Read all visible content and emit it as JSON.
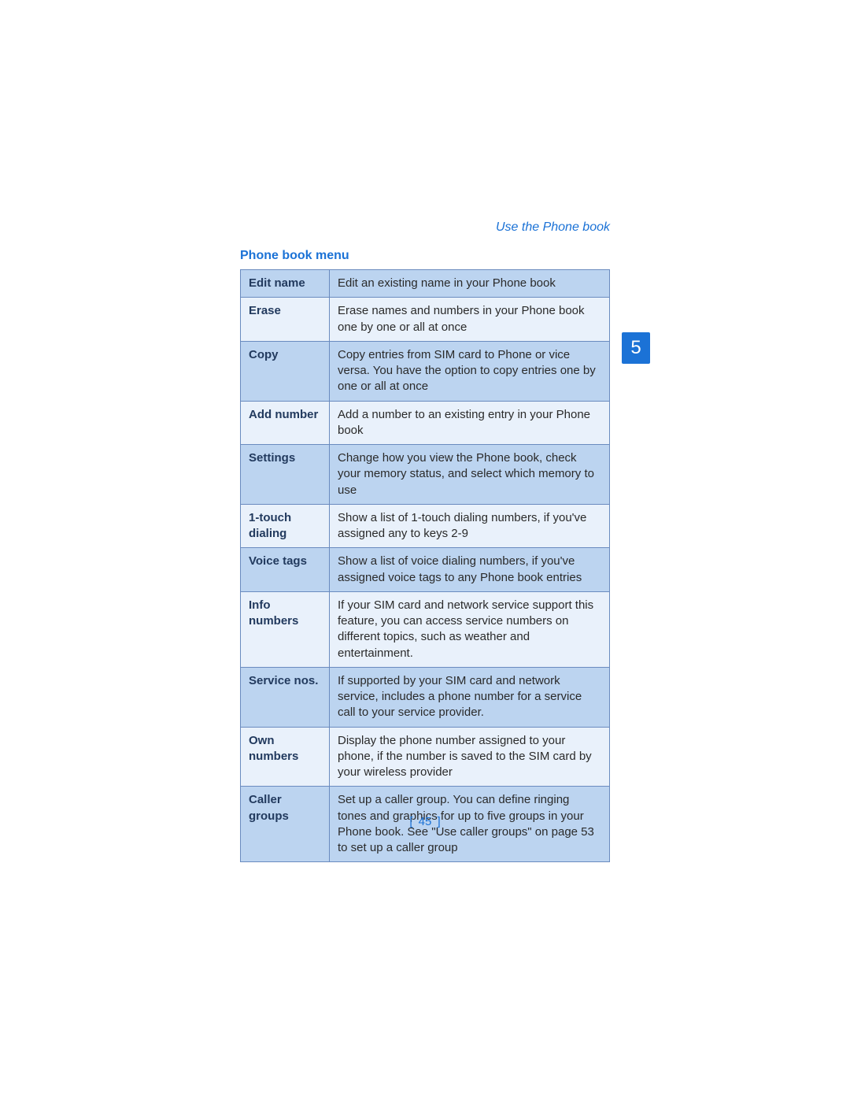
{
  "header": {
    "running_title": "Use the Phone book",
    "section": "Phone book menu",
    "chapter_number": "5"
  },
  "table": {
    "rows": [
      {
        "label": "Edit name",
        "desc": "Edit an existing name in your Phone book"
      },
      {
        "label": "Erase",
        "desc": "Erase names and numbers in your Phone book one by one or all at once"
      },
      {
        "label": "Copy",
        "desc": "Copy entries from SIM card to Phone or vice versa. You have the option to copy entries one by one or all at once"
      },
      {
        "label": "Add number",
        "desc": "Add a number to an existing entry in your Phone book"
      },
      {
        "label": "Settings",
        "desc": "Change how you view the Phone book, check your memory status, and select which memory to use"
      },
      {
        "label": "1-touch dialing",
        "desc": "Show a list of 1-touch dialing numbers, if you've assigned any to keys 2-9"
      },
      {
        "label": "Voice tags",
        "desc": "Show a list of voice dialing numbers, if you've assigned voice tags to any Phone book entries"
      },
      {
        "label": "Info numbers",
        "desc": "If your SIM card and network service support this feature, you can access service numbers on different topics, such as weather and entertainment."
      },
      {
        "label": "Service nos.",
        "desc": "If supported by your SIM card and network service, includes a phone number for a service call to your service provider."
      },
      {
        "label": "Own numbers",
        "desc": "Display the phone number assigned to your phone, if the number is saved to the SIM card by your wireless provider"
      },
      {
        "label": "Caller groups",
        "desc": "Set up a caller group. You can define ringing tones and graphics for up to five groups in your Phone book. See \"Use caller groups\" on page 53 to set up a caller group"
      }
    ]
  },
  "footer": {
    "page_number": "45",
    "left_bracket": "[",
    "right_bracket": "]"
  }
}
